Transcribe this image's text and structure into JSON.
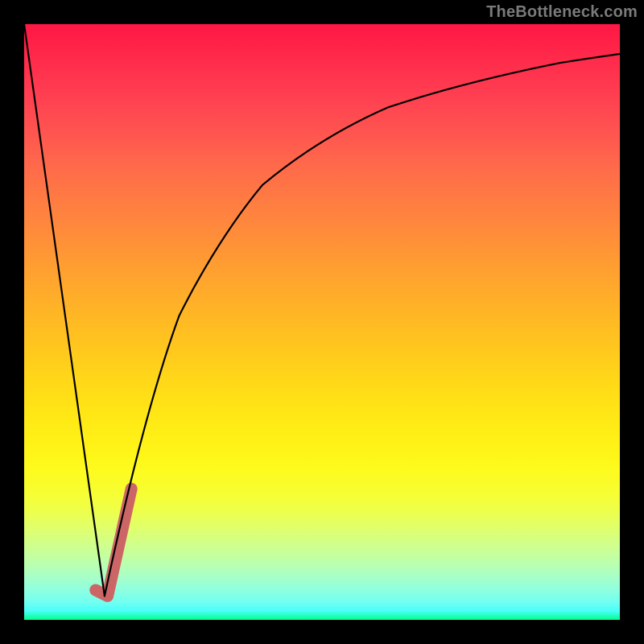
{
  "watermark": {
    "text": "TheBottleneck.com"
  },
  "chart_data": {
    "type": "line",
    "title": "",
    "xlabel": "",
    "ylabel": "",
    "xlim": [
      0,
      100
    ],
    "ylim": [
      0,
      100
    ],
    "grid": false,
    "legend": false,
    "series": [
      {
        "name": "descending-left-line",
        "x": [
          0,
          13.5
        ],
        "values": [
          100,
          4
        ],
        "stroke": "#000000",
        "stroke_width": 2.2
      },
      {
        "name": "ascending-right-curve",
        "x": [
          13.5,
          18,
          22,
          26,
          30,
          35,
          40,
          46,
          53,
          61,
          70,
          80,
          90,
          100
        ],
        "values": [
          4,
          25,
          40,
          51,
          59,
          67,
          73,
          78,
          82.5,
          86,
          89,
          91.5,
          93.5,
          95
        ],
        "stroke": "#000000",
        "stroke_width": 2.2
      },
      {
        "name": "highlight-segment",
        "x": [
          12,
          14,
          18
        ],
        "values": [
          5,
          4,
          22
        ],
        "stroke": "#cc6666",
        "stroke_width": 15
      }
    ],
    "background_gradient": {
      "top": "#ff1744",
      "mid": "#ffe815",
      "bottom": "#00ff88"
    }
  }
}
